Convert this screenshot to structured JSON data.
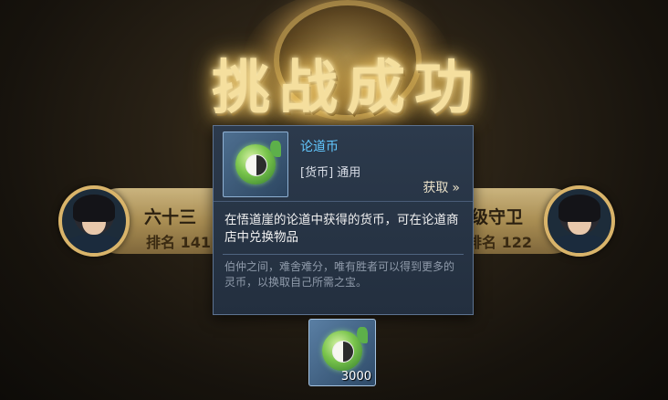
{
  "title": "挑战成功",
  "left_player": {
    "name": "六十三",
    "rank_label": "排名",
    "rank": "141"
  },
  "right_player": {
    "name": "级守卫",
    "rank_label": "排名",
    "rank": "122"
  },
  "tooltip": {
    "item_name": "论道币",
    "item_type": "[货币] 通用",
    "get_label": "获取",
    "get_icon": "double-chevron-right-icon",
    "description": "在悟道崖的论道中获得的货币，可在论道商店中兑换物品",
    "flavor": "伯仲之间，难舍难分，唯有胜者可以得到更多的灵币，以换取自己所需之宝。"
  },
  "reward": {
    "quantity": "3000",
    "icon": "daoist-coin-icon"
  },
  "colors": {
    "title": "#f5df9e",
    "item_name": "#62c8ff",
    "panel": "#2c3a4c"
  }
}
